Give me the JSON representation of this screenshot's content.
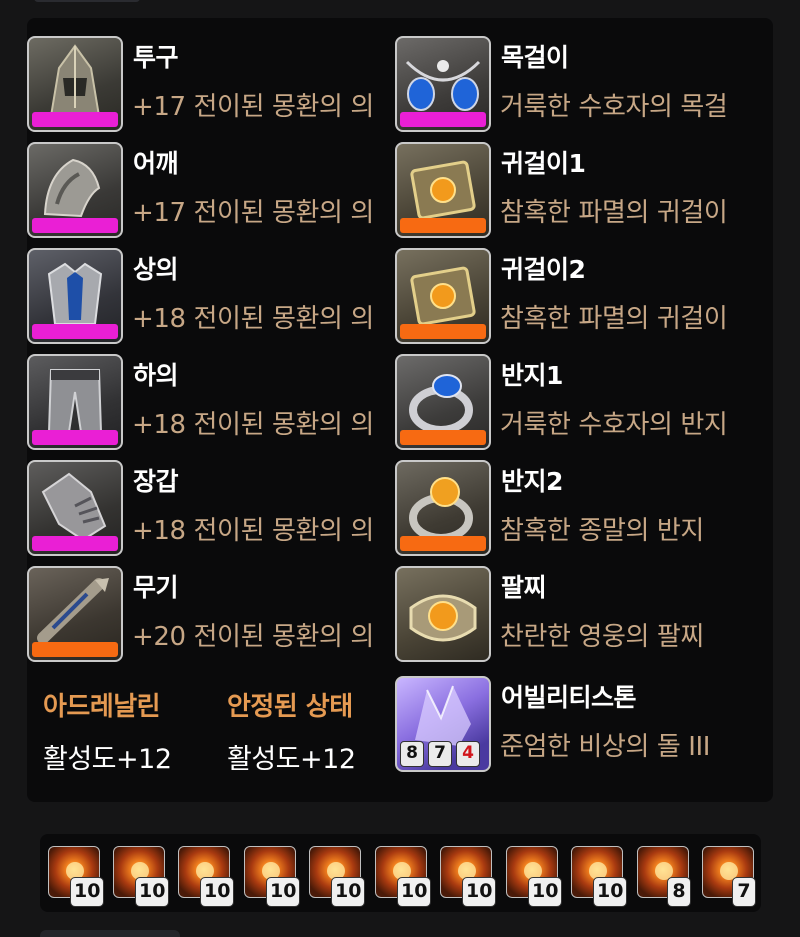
{
  "equipment": {
    "left": [
      {
        "name": "투구",
        "item": "+17 전이된 몽환의 의",
        "quality_color": "#ea1fd5"
      },
      {
        "name": "어깨",
        "item": "+17 전이된 몽환의 의",
        "quality_color": "#ea1fd5"
      },
      {
        "name": "상의",
        "item": "+18 전이된 몽환의 의",
        "quality_color": "#ea1fd5"
      },
      {
        "name": "하의",
        "item": "+18 전이된 몽환의 의",
        "quality_color": "#ea1fd5"
      },
      {
        "name": "장갑",
        "item": "+18 전이된 몽환의 의",
        "quality_color": "#ea1fd5"
      },
      {
        "name": "무기",
        "item": "+20 전이된 몽환의 의",
        "quality_color": "#f76a12"
      }
    ],
    "right": [
      {
        "name": "목걸이",
        "item": "거룩한 수호자의 목걸",
        "quality_color": "#ea1fd5"
      },
      {
        "name": "귀걸이1",
        "item": "참혹한 파멸의 귀걸이",
        "quality_color": "#f76a12"
      },
      {
        "name": "귀걸이2",
        "item": "참혹한 파멸의 귀걸이",
        "quality_color": "#f76a12"
      },
      {
        "name": "반지1",
        "item": "거룩한 수호자의 반지",
        "quality_color": "#f76a12"
      },
      {
        "name": "반지2",
        "item": "참혹한 종말의 반지",
        "quality_color": "#f76a12"
      },
      {
        "name": "팔찌",
        "item": "찬란한 영웅의 팔찌"
      }
    ]
  },
  "engravings": [
    {
      "name": "아드레날린",
      "value": "활성도+12"
    },
    {
      "name": "안정된 상태",
      "value": "활성도+12"
    }
  ],
  "ability_stone": {
    "name": "어빌리티스톤",
    "item": "준엄한 비상의 돌 III",
    "levels": [
      "8",
      "7",
      "4"
    ]
  },
  "gems": [
    "10",
    "10",
    "10",
    "10",
    "10",
    "10",
    "10",
    "10",
    "10",
    "8",
    "7"
  ],
  "colors": {
    "background": "#151516",
    "panel": "#0a0a0b",
    "slot_name": "#ffffff",
    "item_text": "#c7a786",
    "engraving_name": "#e59a52",
    "quality_pink": "#ea1fd5",
    "quality_orange": "#f76a12",
    "stone_penalty": "#d1161c"
  },
  "icons": {
    "helmet": "helmet-icon",
    "shoulder": "shoulder-armor-icon",
    "chest": "chest-armor-icon",
    "pants": "pants-armor-icon",
    "gloves": "gauntlet-icon",
    "weapon": "weapon-icon",
    "necklace": "necklace-icon",
    "earring": "earring-icon",
    "ring": "ring-icon",
    "bracelet": "bracelet-icon",
    "stone": "ability-stone-icon",
    "gem": "gem-icon"
  }
}
